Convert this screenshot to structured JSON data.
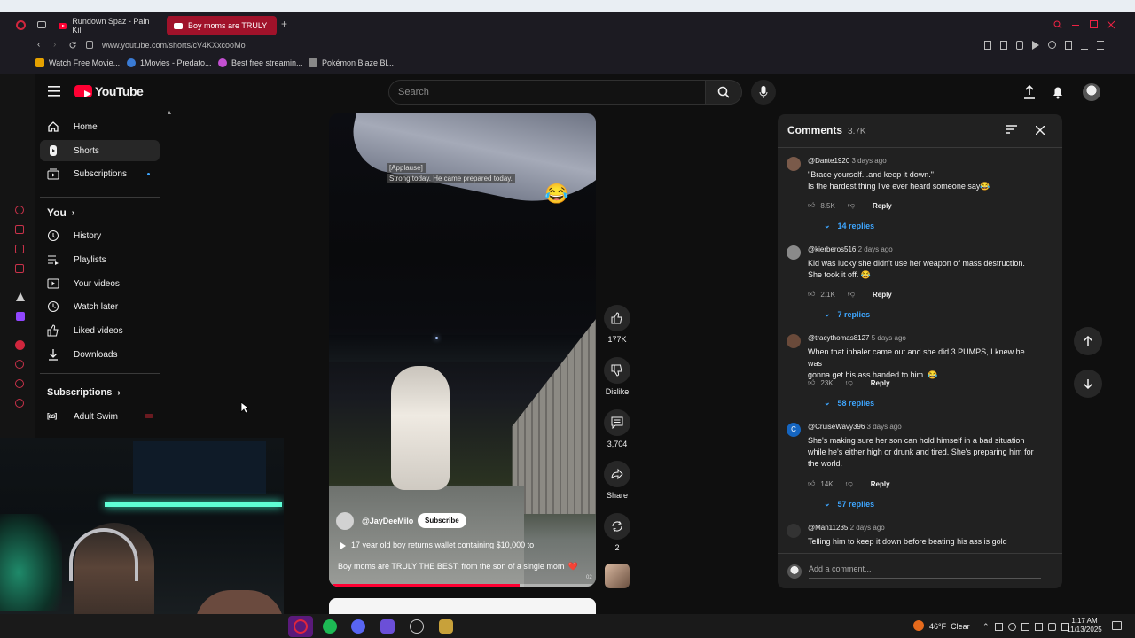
{
  "browser": {
    "tabs": [
      {
        "label": "Rundown Spaz - Pain Kil"
      },
      {
        "label": "Boy moms are TRULY"
      }
    ],
    "new_tab_label": "+",
    "url": "www.youtube.com/shorts/cV4KXxcooMo",
    "bookmarks": [
      {
        "label": "Watch Free Movie..."
      },
      {
        "label": "1Movies - Predato..."
      },
      {
        "label": "Best free streamin..."
      },
      {
        "label": "Pokémon Blaze Bl..."
      }
    ]
  },
  "header": {
    "logo_text": "YouTube",
    "search_placeholder": "Search"
  },
  "sidebar": {
    "main": [
      {
        "label": "Home",
        "icon": "home-icon"
      },
      {
        "label": "Shorts",
        "icon": "shorts-icon"
      },
      {
        "label": "Subscriptions",
        "icon": "subscriptions-icon"
      }
    ],
    "you_title": "You",
    "you_items": [
      {
        "label": "History",
        "icon": "history-icon"
      },
      {
        "label": "Playlists",
        "icon": "playlists-icon"
      },
      {
        "label": "Your videos",
        "icon": "your-videos-icon"
      },
      {
        "label": "Watch later",
        "icon": "watch-later-icon"
      },
      {
        "label": "Liked videos",
        "icon": "liked-videos-icon"
      },
      {
        "label": "Downloads",
        "icon": "downloads-icon"
      }
    ],
    "subscriptions_title": "Subscriptions",
    "channels": [
      {
        "label": "Adult Swim"
      }
    ]
  },
  "video": {
    "caption_line1": "[Applause]",
    "caption_line2": "Strong today. He came prepared today.",
    "emoji": "😂",
    "channel": "@JayDeeMilo",
    "subscribe_label": "Subscribe",
    "title_line1": "17 year old boy returns wallet containing $10,000 to",
    "title_line2": "Boy moms are TRULY THE BEST; from the son of a single mom",
    "heart": "❤️",
    "time_label": "02",
    "progress_fraction": 0.72
  },
  "actions": {
    "like_count": "177K",
    "dislike_label": "Dislike",
    "comment_count": "3,704",
    "share_label": "Share",
    "remix_count": "2"
  },
  "comments": {
    "title": "Comments",
    "count": "3.7K",
    "items": [
      {
        "user": "@Dante1920",
        "ago": "3 days ago",
        "line1": "\"Brace yourself...and keep it down.\"",
        "line2": "Is the hardest thing I've ever heard someone say😂",
        "likes": "8.5K",
        "reply_label": "Reply",
        "replies": "14 replies",
        "avatar_color": "#7a5a4a"
      },
      {
        "user": "@kierberos516",
        "ago": "2 days ago",
        "line1": "Kid was lucky she didn't use her weapon of mass destruction.",
        "line2": "She took it off. 😂",
        "likes": "2.1K",
        "reply_label": "Reply",
        "replies": "7 replies",
        "avatar_color": "#8a8a8a"
      },
      {
        "user": "@tracythomas8127",
        "ago": "5 days ago",
        "line1": "When that inhaler came out and she did 3 PUMPS, I knew he was",
        "line2": "gonna get his ass handed to him. 😂",
        "likes": "23K",
        "reply_label": "Reply",
        "replies": "58 replies",
        "avatar_color": "#6a4a3a"
      },
      {
        "user": "@CruiseWavy396",
        "ago": "3 days ago",
        "line1": "She's making sure her son can hold himself in a bad situation",
        "line2": "while he's either high or drunk and tired. She's preparing him for",
        "line3": "the world.",
        "likes": "14K",
        "reply_label": "Reply",
        "replies": "57 replies",
        "avatar_letter": "C",
        "avatar_color": "#1565c0"
      },
      {
        "user": "@Man11235",
        "ago": "2 days ago",
        "line1": "Telling him to keep it down before beating his ass is gold",
        "avatar_color": "#333333"
      }
    ],
    "add_placeholder": "Add a comment..."
  },
  "taskbar": {
    "weather": "46°F  Clear",
    "time": "1:17 AM",
    "date": "11/13/2025"
  }
}
